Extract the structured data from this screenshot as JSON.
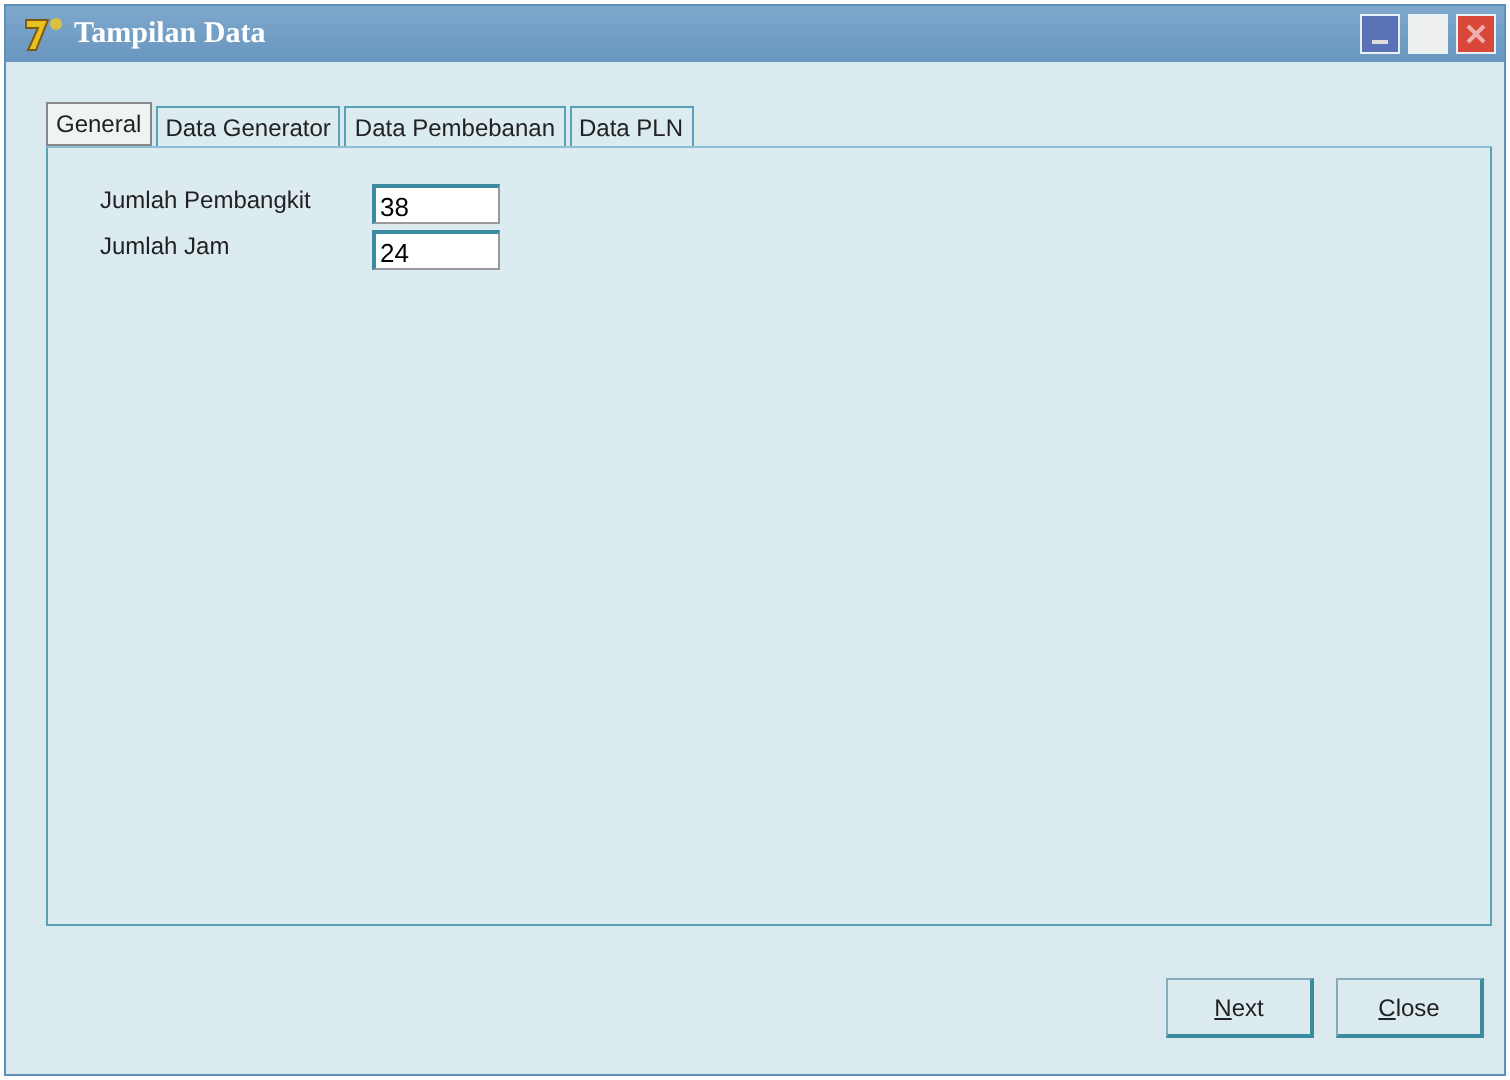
{
  "window": {
    "title": "Tampilan Data"
  },
  "tabs": [
    {
      "label": "General",
      "selected": true
    },
    {
      "label": "Data Generator",
      "selected": false
    },
    {
      "label": "Data Pembebanan",
      "selected": false
    },
    {
      "label": "Data PLN",
      "selected": false
    }
  ],
  "fields": [
    {
      "label": "Jumlah Pembangkit",
      "value": "38"
    },
    {
      "label": "Jumlah Jam",
      "value": "24"
    }
  ],
  "buttons": [
    "Next",
    "Close"
  ]
}
